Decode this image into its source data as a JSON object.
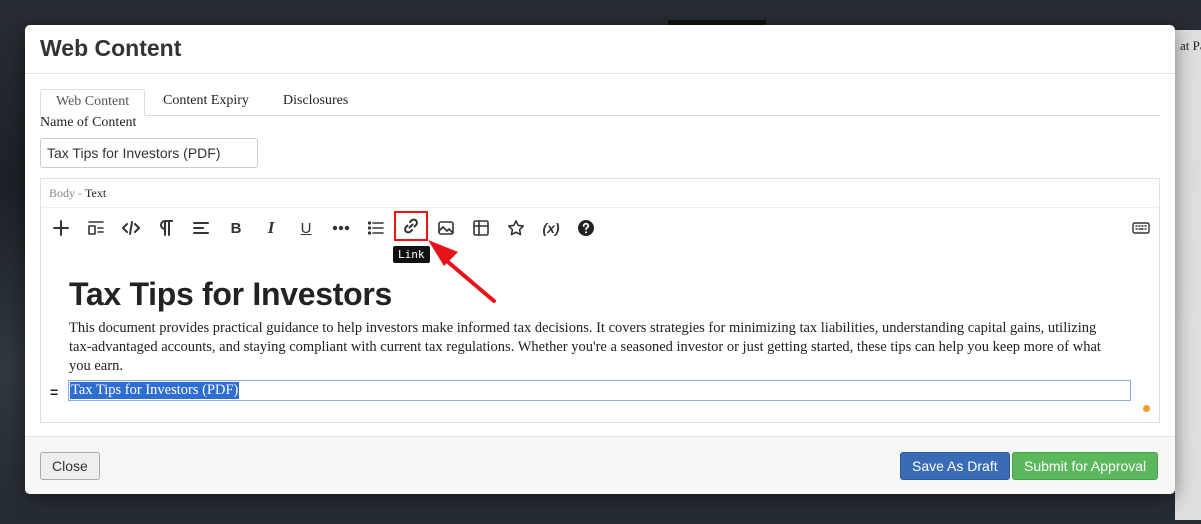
{
  "background": {
    "partial_text": "at Pa"
  },
  "modal": {
    "title": "Web Content",
    "tabs": [
      {
        "label": "Web Content",
        "active": true
      },
      {
        "label": "Content Expiry",
        "active": false
      },
      {
        "label": "Disclosures",
        "active": false
      }
    ],
    "name_label": "Name of Content",
    "name_value": "Tax Tips for Investors (PDF)",
    "editor": {
      "label_prefix": "Body -",
      "label_type": "Text",
      "toolbar": [
        {
          "name": "add-icon"
        },
        {
          "name": "block-format-icon"
        },
        {
          "name": "source-code-icon"
        },
        {
          "name": "paragraph-icon"
        },
        {
          "name": "align-icon"
        },
        {
          "name": "bold-icon",
          "glyph": "B"
        },
        {
          "name": "italic-icon",
          "glyph": "I"
        },
        {
          "name": "underline-icon",
          "glyph": "U"
        },
        {
          "name": "more-icon"
        },
        {
          "name": "list-icon"
        },
        {
          "name": "link-icon",
          "highlighted": true
        },
        {
          "name": "image-icon"
        },
        {
          "name": "table-icon"
        },
        {
          "name": "star-icon"
        },
        {
          "name": "variable-icon",
          "glyph": "(x)"
        },
        {
          "name": "help-icon"
        },
        {
          "name": "keyboard-icon"
        }
      ],
      "tooltip": "Link",
      "heading": "Tax Tips for Investors",
      "paragraph": "This document provides practical guidance to help investors make informed tax decisions. It covers strategies for minimizing tax liabilities, understanding capital gains, utilizing tax-advantaged accounts, and staying compliant with current tax regulations. Whether you're a seasoned investor or just getting started, these tips can help you keep more of what you earn.",
      "selected_text": "Tax Tips for Investors (PDF)",
      "drag_handle": "="
    },
    "footer": {
      "close_label": "Close",
      "draft_label": "Save As Draft",
      "submit_label": "Submit for Approval"
    }
  },
  "colors": {
    "accent_blue": "#3a6bb5",
    "accent_green": "#5cb85c",
    "highlight_red": "#e11111",
    "selection": "#2f6ed1"
  }
}
